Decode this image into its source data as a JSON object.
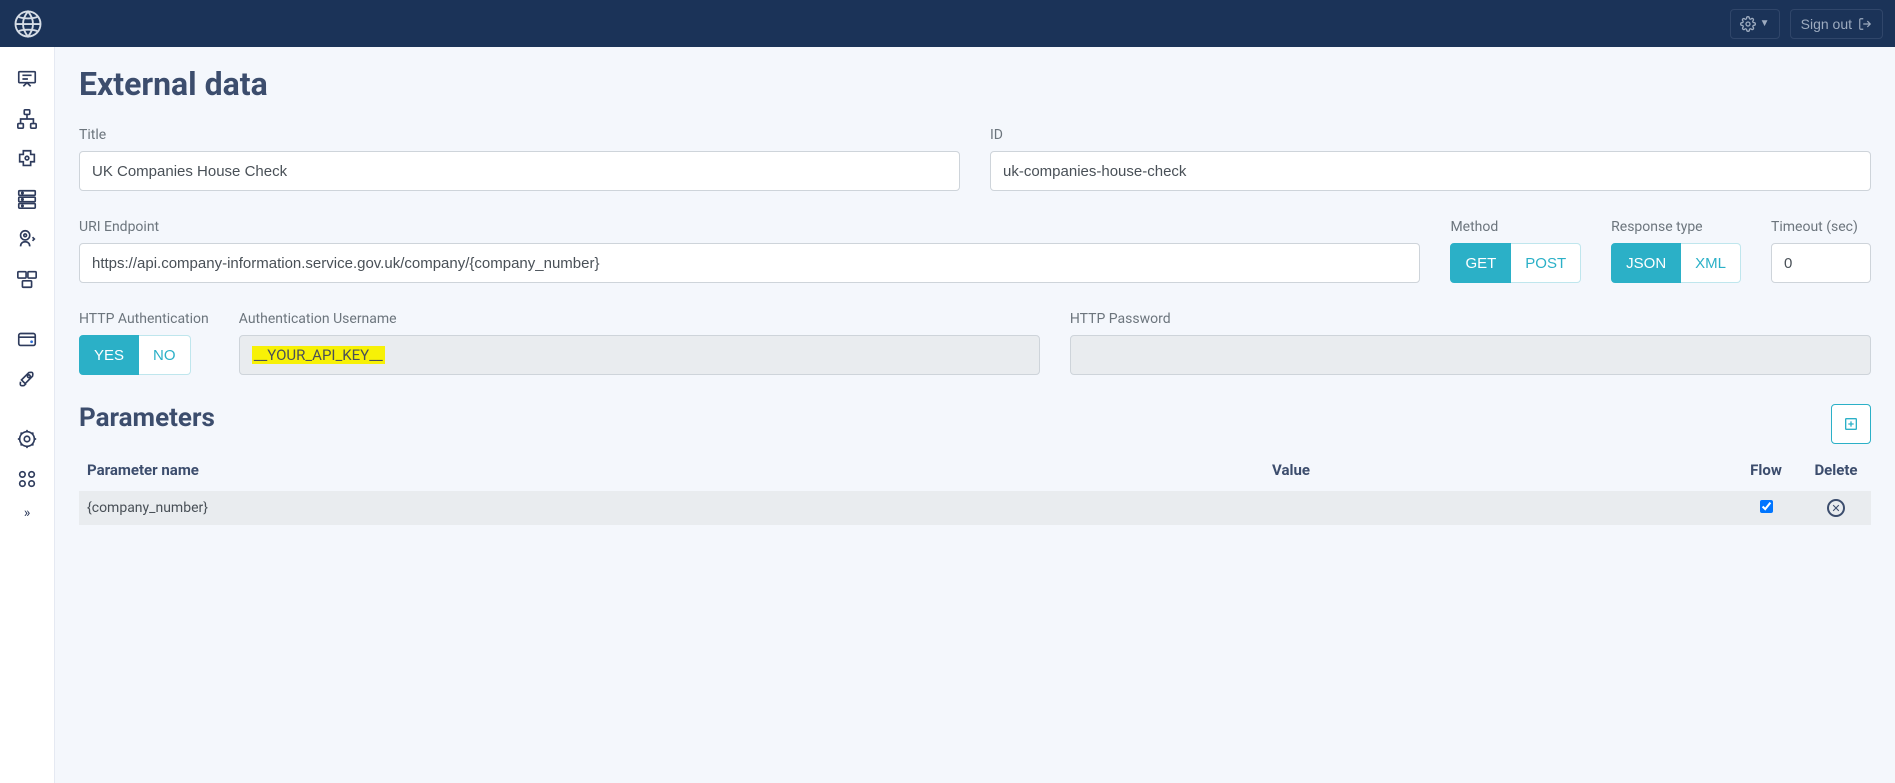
{
  "topbar": {
    "signout_label": "Sign out"
  },
  "page": {
    "title": "External data"
  },
  "form": {
    "title_label": "Title",
    "title_value": "UK Companies House Check",
    "id_label": "ID",
    "id_value": "uk-companies-house-check",
    "uri_label": "URI Endpoint",
    "uri_value": "https://api.company-information.service.gov.uk/company/{company_number}",
    "method_label": "Method",
    "method_get": "GET",
    "method_post": "POST",
    "response_label": "Response type",
    "response_json": "JSON",
    "response_xml": "XML",
    "timeout_label": "Timeout (sec)",
    "timeout_value": "0",
    "httpauth_label": "HTTP Authentication",
    "httpauth_yes": "YES",
    "httpauth_no": "NO",
    "authuser_label": "Authentication Username",
    "authuser_value": "__YOUR_API_KEY__",
    "httppass_label": "HTTP Password",
    "httppass_value": ""
  },
  "parameters": {
    "title": "Parameters",
    "col_name": "Parameter name",
    "col_value": "Value",
    "col_flow": "Flow",
    "col_delete": "Delete",
    "rows": [
      {
        "name": "{company_number}",
        "value": "",
        "flow": true
      }
    ]
  }
}
